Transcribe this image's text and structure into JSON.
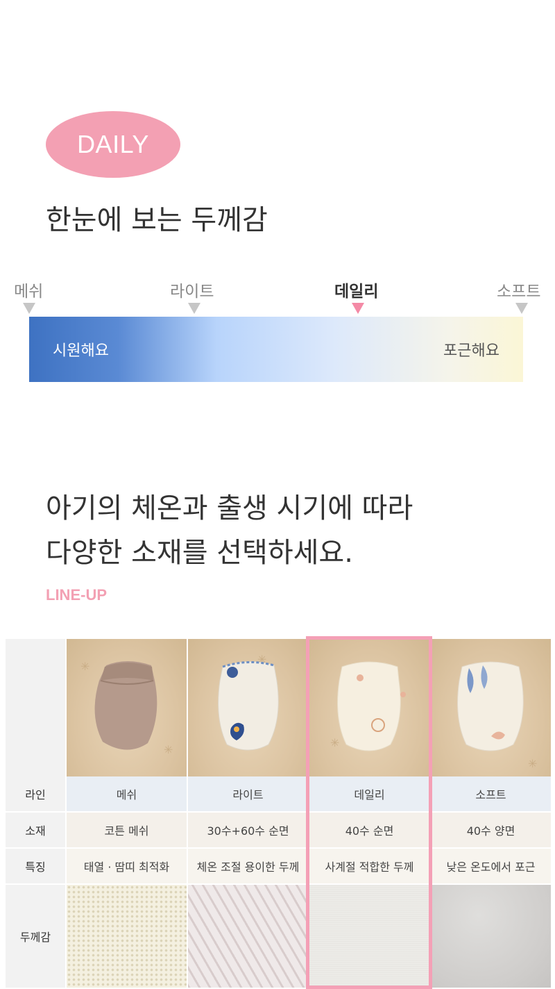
{
  "header": {
    "badge": "DAILY",
    "title": "한눈에 보는 두께감"
  },
  "scale": {
    "labels": [
      "메쉬",
      "라이트",
      "데일리",
      "소프트"
    ],
    "active_index": 2,
    "bar_left": "시원해요",
    "bar_right": "포근해요"
  },
  "headline": {
    "line1": "아기의 체온과 출생 시기에 따라",
    "line2": "다양한 소재를 선택하세요."
  },
  "lineup_label": "LINE-UP",
  "table": {
    "row_labels": {
      "line": "라인",
      "material": "소재",
      "feature": "특징",
      "thickness": "두께감"
    },
    "products": [
      {
        "line": "메쉬",
        "material": "코튼 메쉬",
        "feature": "태열 · 땀띠 최적화",
        "mitten_color": "#b49a8c",
        "print": "none"
      },
      {
        "line": "라이트",
        "material": "30수+60수 순면",
        "feature": "체온 조절 용이한 두께",
        "mitten_color": "#f2ede3",
        "print": "blue-heart"
      },
      {
        "line": "데일리",
        "material": "40수 순면",
        "feature": "사계절 적합한 두께",
        "mitten_color": "#f6efe0",
        "print": "bear"
      },
      {
        "line": "소프트",
        "material": "40수 양면",
        "feature": "낮은 온도에서 포근",
        "mitten_color": "#f4eee2",
        "print": "blue-leaf"
      }
    ],
    "highlighted_index": 2
  },
  "colors": {
    "accent_pink": "#f3a0b3",
    "highlight_border": "#f4a0b6",
    "gradient_cool": "#3e72c2",
    "gradient_warm": "#fbf6d6"
  }
}
